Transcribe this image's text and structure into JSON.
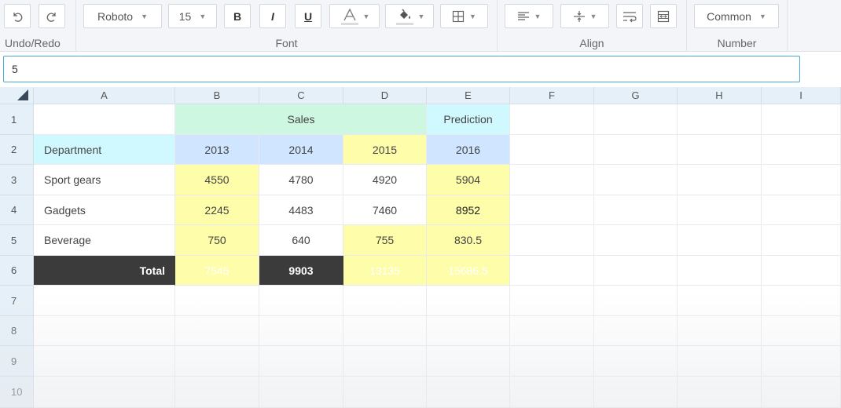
{
  "toolbar": {
    "groups": {
      "undo_redo": "Undo/Redo",
      "font": "Font",
      "align": "Align",
      "number": "Number"
    },
    "font_family": "Roboto",
    "font_size": "15",
    "bold": "B",
    "italic": "I",
    "underline": "U",
    "number_format": "Common",
    "icons": [
      "undo-icon",
      "redo-icon",
      "text-color-icon",
      "background-color-icon",
      "borders-icon",
      "horizontal-align-icon",
      "vertical-align-icon",
      "text-wrap-icon",
      "merge-cells-icon"
    ]
  },
  "formula_bar": {
    "value": "5"
  },
  "columns": [
    "A",
    "B",
    "C",
    "D",
    "E",
    "F",
    "G",
    "H",
    "I"
  ],
  "rows": [
    "1",
    "2",
    "3",
    "4",
    "5",
    "6",
    "7",
    "8",
    "9",
    "10"
  ],
  "cells": {
    "C1": "Sales",
    "E1": "Prediction",
    "A2": "Department",
    "B2": "2013",
    "C2": "2014",
    "D2": "2015",
    "E2": "2016",
    "A3": "Sport gears",
    "B3": "4550",
    "C3": "4780",
    "D3": "4920",
    "E3": "5904",
    "A4": "Gadgets",
    "B4": "2245",
    "C4": "4483",
    "D4": "7460",
    "E4": "8952",
    "A5": "Beverage",
    "B5": "750",
    "C5": "640",
    "D5": "755",
    "E5": "830.5",
    "A6": "Total",
    "B6": "7545",
    "C6": "9903",
    "D6": "13135",
    "E6": "15686.5"
  },
  "colors": {
    "header_green": "#cdf7e1",
    "cyan": "#cff9ff",
    "blue": "#d0e5ff",
    "yellow": "#fefda9",
    "total_dark": "#3b3b3b",
    "formula_border": "#4aa8d8"
  }
}
